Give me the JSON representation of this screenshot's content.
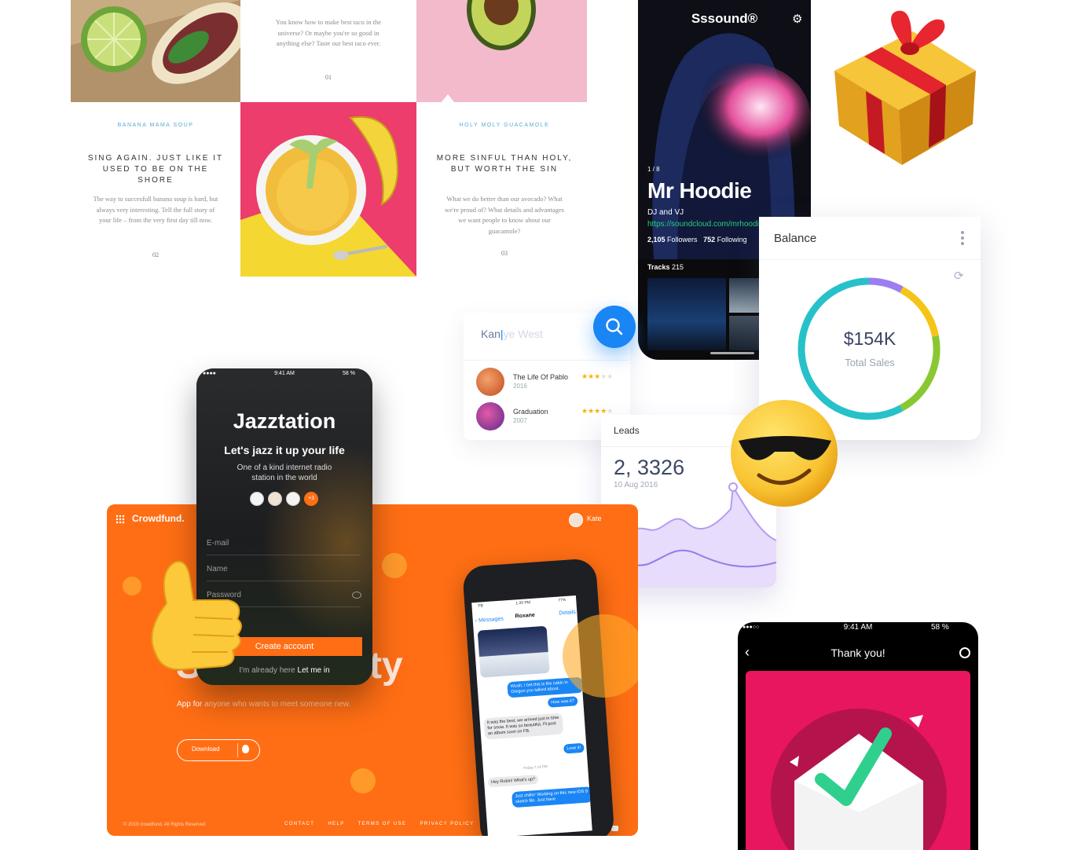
{
  "food": {
    "tile1": {
      "body": "You know how to make best taco in the universe? Or maybe you're so good in anything else? Taste our best taco ever.",
      "number": "01"
    },
    "tile2": {
      "kicker": "BANANA MAMA SOUP",
      "headline": "SING AGAIN. JUST LIKE IT USED TO BE ON THE SHORE",
      "body": "The way to succesfull banana soup is hard, but always very interesting. Tell the full story of your life – from the very first day till now.",
      "number": "02"
    },
    "tile3": {
      "kicker": "HOLY MOLY GUACAMOLE",
      "headline": "MORE SINFUL THAN HOLY, BUT WORTH THE SIN",
      "body": "What we do better than our avocado? What we're proud of? What details and advantages we want people to know about our guacamole?",
      "number": "03"
    }
  },
  "sound": {
    "brand": "Sssound®",
    "pager": "1 / 8",
    "artist": "Mr Hoodie",
    "role": "DJ and VJ",
    "url": "https://soundcloud.com/mrhoodie",
    "followers_count": "2,105",
    "followers_label": "Followers",
    "following_count": "752",
    "following_label": "Following",
    "tracks_label": "Tracks",
    "tracks_count": "215"
  },
  "balance": {
    "title": "Balance",
    "value": "$154K",
    "label": "Total Sales",
    "ring": [
      {
        "color": "#9c7ef0",
        "fraction": 0.08
      },
      {
        "color": "#f6c416",
        "fraction": 0.14
      },
      {
        "color": "#8ac832",
        "fraction": 0.2
      },
      {
        "color": "#27c1c9",
        "fraction": 0.58
      }
    ]
  },
  "search": {
    "typed": "Kan",
    "suggestion": "ye West",
    "results": [
      {
        "title": "The Life Of Pablo",
        "year": "2016",
        "stars": "★★★",
        "rest": "★★"
      },
      {
        "title": "Graduation",
        "year": "2007",
        "stars": "★★★★",
        "rest": "★"
      }
    ]
  },
  "leads": {
    "title": "Leads",
    "value": "2, 3326",
    "date": "10 Aug 2016"
  },
  "jazz": {
    "time": "9:41 AM",
    "battery": "58 %",
    "title": "Jazztation",
    "tagline": "Let's jazz it up your life",
    "subtitle": "One of a kind internet radio station in the world",
    "more": "+3",
    "email": "E-mail",
    "name": "Name",
    "password": "Password",
    "cta": "Create account",
    "already": "I'm already here",
    "login": "Let me in"
  },
  "crowd": {
    "brand": "Crowdfund.",
    "user": "Kate",
    "headline_tail": "ty",
    "headline_start": "S",
    "desc_start": "App for ",
    "desc_rest": "anyone who wants to meet someone new.",
    "download": "Download",
    "copyright": "© 2019 crowdfund. All Rights Reserved",
    "links": [
      "CONTACT",
      "HELP",
      "TERMS OF USE",
      "PRIVACY POLICY"
    ]
  },
  "messages": {
    "time": "1:20 PM",
    "carrier": "FB",
    "battery": "77%",
    "back": "Messages",
    "contact": "Roxane",
    "details": "Details",
    "b1": "Woah, I bet this is the cabin in Oregon you talked about.",
    "b2": "How was it?",
    "b3": "It was the best, we arrived just in time for snow. It was so beautiful, I'll post an album soon on FB.",
    "b4": "Love it!",
    "day": "Friday 7:14 PM",
    "b5": "Hey Robin! What's up?",
    "b6": "Just chillin' Working on this new iOS 9 sketch file. Just have"
  },
  "thanks": {
    "time": "9:41 AM",
    "battery": "58 %",
    "title": "Thank you!"
  },
  "colors": {
    "orange": "#ff6e14",
    "blue": "#1a86f5",
    "teal": "#27c1c9",
    "pink": "#e8165e",
    "green": "#2fd08d"
  }
}
